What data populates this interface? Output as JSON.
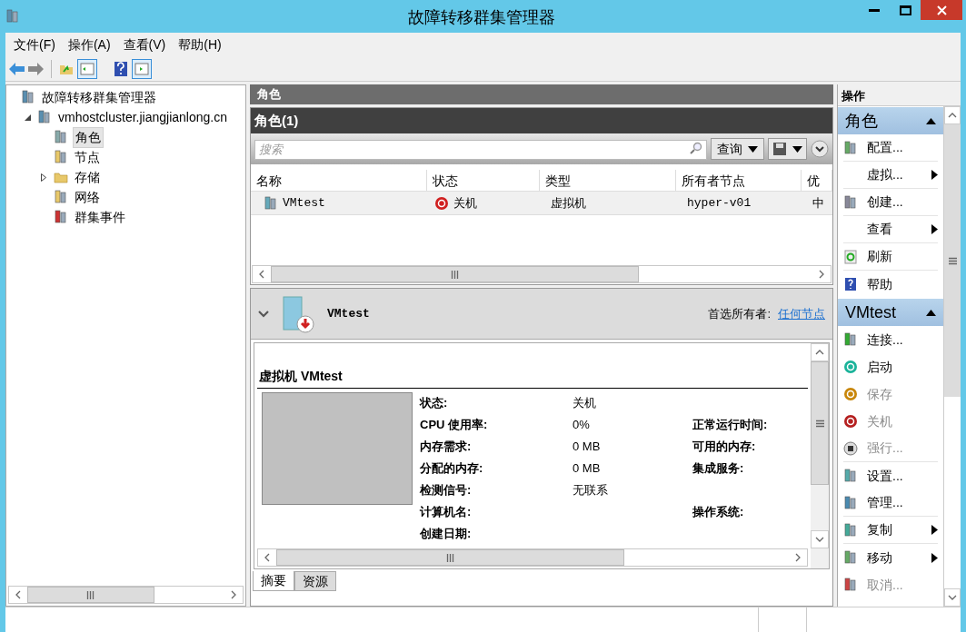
{
  "window": {
    "title": "故障转移群集管理器"
  },
  "menu": [
    "文件(F)",
    "操作(A)",
    "查看(V)",
    "帮助(H)"
  ],
  "tree": [
    {
      "label": "故障转移群集管理器",
      "selected": false,
      "children": [
        {
          "label": "vmhostcluster.jiangjianlong.cn",
          "expanded": true,
          "selected": false,
          "children": [
            {
              "label": "角色",
              "selected": true
            },
            {
              "label": "节点",
              "selected": false
            },
            {
              "label": "存储",
              "expanded": false,
              "selected": false
            },
            {
              "label": "网络",
              "selected": false
            },
            {
              "label": "群集事件",
              "selected": false
            }
          ]
        }
      ]
    }
  ],
  "center": {
    "header": "角色",
    "panel_title": "角色(1)",
    "search": {
      "placeholder": "搜索"
    },
    "query_button": "查询",
    "table": {
      "columns": [
        "名称",
        "状态",
        "类型",
        "所有者节点",
        "优"
      ],
      "rows": [
        {
          "cells": [
            "VMtest",
            "关机",
            "虚拟机",
            "hyper-v01",
            "中"
          ],
          "selected": true
        }
      ]
    },
    "details": {
      "name": "VMtest",
      "preferred_label": "首选所有者:",
      "preferred_link": "任何节点",
      "section_title": "虚拟机 VMtest",
      "fields": [
        {
          "label": "状态:",
          "value": "关机"
        },
        {
          "label": "CPU 使用率:",
          "value": "0%",
          "right_label": "正常运行时间:"
        },
        {
          "label": "内存需求:",
          "value": "0 MB",
          "right_label": "可用的内存:"
        },
        {
          "label": "分配的内存:",
          "value": "0 MB",
          "right_label": "集成服务:"
        },
        {
          "label": "检测信号:",
          "value": "无联系"
        },
        {
          "label": "计算机名:",
          "right_label": "操作系统:"
        },
        {
          "label": "创建日期:"
        }
      ],
      "tabs": [
        {
          "label": "摘要",
          "selected": true
        },
        {
          "label": "资源",
          "selected": false
        }
      ]
    }
  },
  "actions": {
    "header": "操作",
    "groups": [
      {
        "title": "角色",
        "items": [
          {
            "label": "配置...",
            "disabled": false,
            "submenu": false,
            "separator_after": true
          },
          {
            "label": "虚拟...",
            "disabled": false,
            "submenu": true,
            "separator_after": true
          },
          {
            "label": "创建...",
            "disabled": false,
            "submenu": false,
            "separator_after": true
          },
          {
            "label": "查看",
            "disabled": false,
            "submenu": true,
            "separator_after": true
          },
          {
            "label": "刷新",
            "disabled": false,
            "submenu": false,
            "separator_after": true
          },
          {
            "label": "帮助",
            "disabled": false,
            "submenu": false,
            "separator_after": false
          }
        ]
      },
      {
        "title": "VMtest",
        "items": [
          {
            "label": "连接...",
            "disabled": false,
            "submenu": false,
            "separator_after": false
          },
          {
            "label": "启动",
            "disabled": false,
            "submenu": false,
            "separator_after": false
          },
          {
            "label": "保存",
            "disabled": true,
            "submenu": false,
            "separator_after": false
          },
          {
            "label": "关机",
            "disabled": true,
            "submenu": false,
            "separator_after": false
          },
          {
            "label": "强行...",
            "disabled": true,
            "submenu": false,
            "separator_after": true
          },
          {
            "label": "设置...",
            "disabled": false,
            "submenu": false,
            "separator_after": false
          },
          {
            "label": "管理...",
            "disabled": false,
            "submenu": false,
            "separator_after": true
          },
          {
            "label": "复制",
            "disabled": false,
            "submenu": true,
            "separator_after": true
          },
          {
            "label": "移动",
            "disabled": false,
            "submenu": true,
            "separator_after": false
          },
          {
            "label": "取消...",
            "disabled": true,
            "submenu": false,
            "separator_after": false
          }
        ]
      }
    ]
  }
}
